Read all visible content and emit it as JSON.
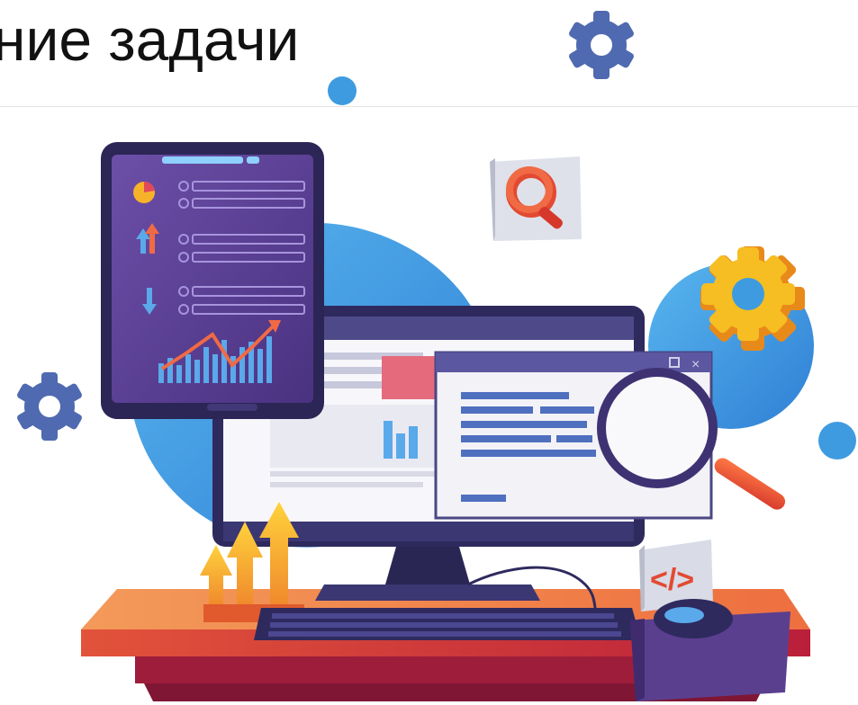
{
  "slide": {
    "title": "ние задачи"
  },
  "illustration": {
    "screen_labels": {
      "code_tile": "</>"
    },
    "icons": [
      "gear-icon",
      "magnifier-icon",
      "search-icon",
      "pie-chart-icon",
      "arrow-up-icon",
      "arrow-down-icon",
      "bar-chart-icon",
      "line-chart-icon",
      "code-icon",
      "mouse-icon",
      "keyboard-icon"
    ],
    "colors": {
      "blue_blob": "#3e9be0",
      "tablet_purple": "#5b3f8f",
      "desk_orange": "#f07a45",
      "desk_red": "#c8283a",
      "gear_yellow": "#f5b51b",
      "search_red": "#e24a32",
      "navy": "#2e2a5e"
    }
  }
}
